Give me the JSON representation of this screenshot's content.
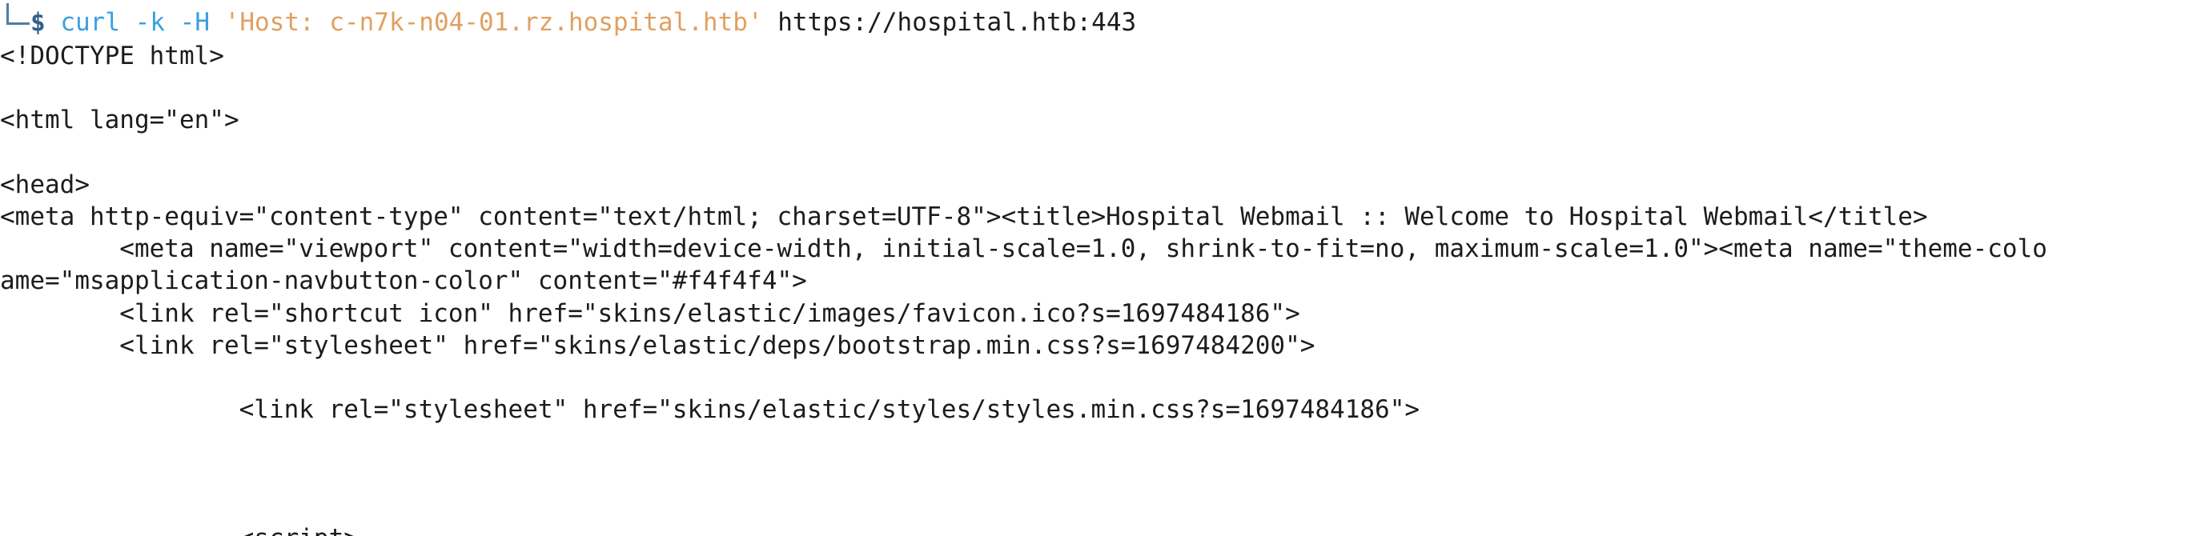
{
  "prompt": {
    "symbol": "$",
    "command": "curl",
    "flags": "-k -H",
    "header_arg": "'Host: c-n7k-n04-01.rz.hospital.htb'",
    "target": "https://hospital.htb:443"
  },
  "output_lines": [
    "<!DOCTYPE html>",
    "",
    "<html lang=\"en\">",
    "",
    "<head>",
    "<meta http-equiv=\"content-type\" content=\"text/html; charset=UTF-8\"><title>Hospital Webmail :: Welcome to Hospital Webmail</title>",
    "        <meta name=\"viewport\" content=\"width=device-width, initial-scale=1.0, shrink-to-fit=no, maximum-scale=1.0\"><meta name=\"theme-colo",
    "ame=\"msapplication-navbutton-color\" content=\"#f4f4f4\">",
    "        <link rel=\"shortcut icon\" href=\"skins/elastic/images/favicon.ico?s=1697484186\">",
    "        <link rel=\"stylesheet\" href=\"skins/elastic/deps/bootstrap.min.css?s=1697484200\">",
    "",
    "                <link rel=\"stylesheet\" href=\"skins/elastic/styles/styles.min.css?s=1697484186\">",
    "",
    "",
    "",
    "                <script>"
  ]
}
